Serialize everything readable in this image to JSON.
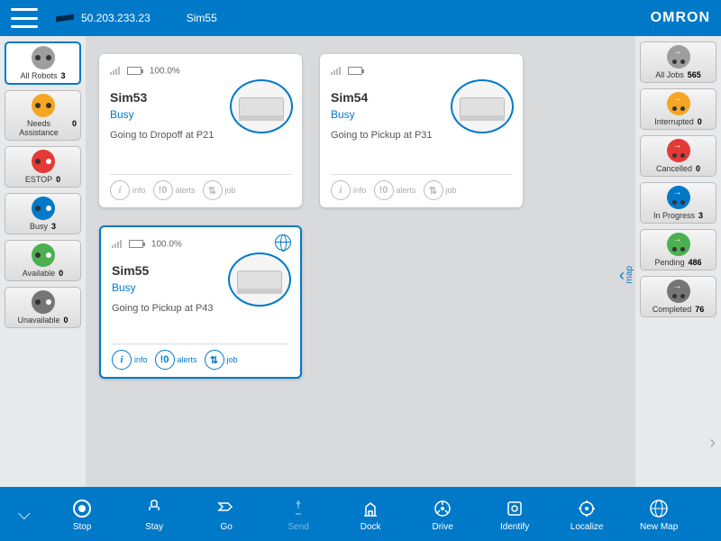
{
  "header": {
    "ip": "50.203.233.23",
    "sim": "Sim55",
    "brand": "OMRON"
  },
  "left": [
    {
      "label": "All Robots",
      "count": "3",
      "color": "gray",
      "sel": true
    },
    {
      "label": "Needs Assistance",
      "count": "0",
      "color": "orange"
    },
    {
      "label": "ESTOP",
      "count": "0",
      "color": "red"
    },
    {
      "label": "Busy",
      "count": "3",
      "color": "blue"
    },
    {
      "label": "Available",
      "count": "0",
      "color": "green"
    },
    {
      "label": "Unavailable",
      "count": "0",
      "color": "dgray"
    }
  ],
  "right": [
    {
      "label": "All Jobs",
      "count": "565",
      "color": "jgray"
    },
    {
      "label": "Interrupted",
      "count": "0",
      "color": "jorange"
    },
    {
      "label": "Cancelled",
      "count": "0",
      "color": "jred"
    },
    {
      "label": "In Progress",
      "count": "3",
      "color": "jblue"
    },
    {
      "label": "Pending",
      "count": "486",
      "color": "jgreen"
    },
    {
      "label": "Completed",
      "count": "76",
      "color": "jdgray"
    }
  ],
  "cards": [
    {
      "name": "Sim53",
      "status": "Busy",
      "task": "Going to Dropoff at P21",
      "pct": "100.0%"
    },
    {
      "name": "Sim54",
      "status": "Busy",
      "task": "Going to Pickup at P31",
      "pct": ""
    },
    {
      "name": "Sim55",
      "status": "Busy",
      "task": "Going to Pickup at P43",
      "pct": "100.0%",
      "sel": true,
      "globe": true
    }
  ],
  "foot": {
    "info": "info",
    "alerts": "alerts",
    "job": "job"
  },
  "map": "map",
  "bottom": [
    {
      "label": "Stop",
      "dim": false
    },
    {
      "label": "Stay",
      "dim": false
    },
    {
      "label": "Go",
      "dim": false
    },
    {
      "label": "Send",
      "dim": true
    },
    {
      "label": "Dock",
      "dim": false
    },
    {
      "label": "Drive",
      "dim": false
    },
    {
      "label": "Identify",
      "dim": false
    },
    {
      "label": "Localize",
      "dim": false
    },
    {
      "label": "New Map",
      "dim": false
    }
  ]
}
